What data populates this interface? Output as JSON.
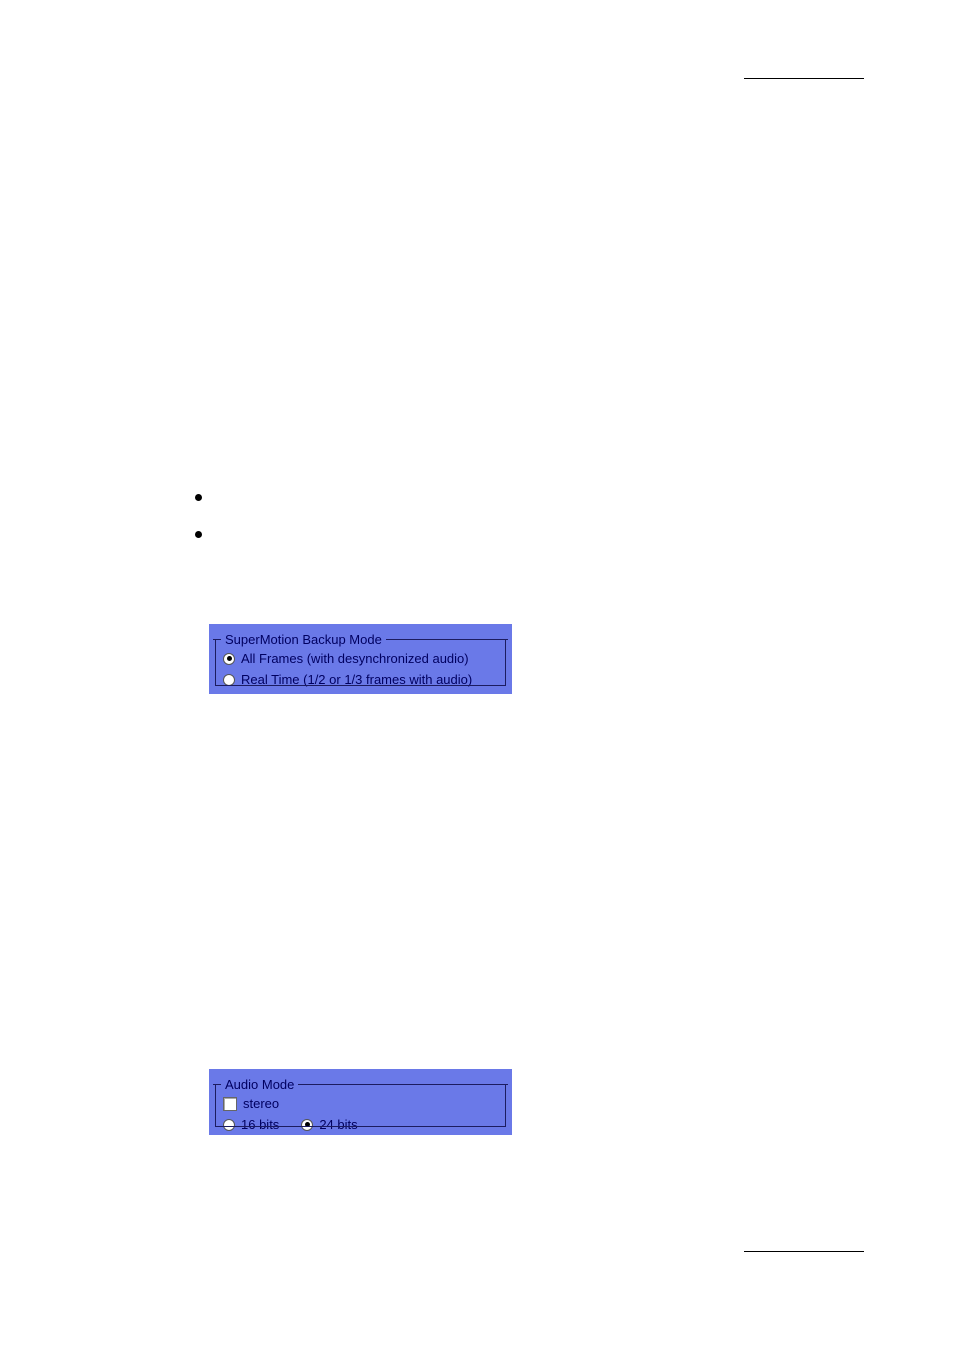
{
  "supermotion": {
    "legend": "SuperMotion Backup Mode",
    "option1_label": "All Frames (with desynchronized audio)",
    "option2_label": "Real Time (1/2 or 1/3 frames with audio)",
    "selected_index": 0
  },
  "audio": {
    "legend": "Audio Mode",
    "checkbox_label": "stereo",
    "checkbox_checked": false,
    "bits16_label": "16 bits",
    "bits24_label": "24 bits",
    "selected_bits_index": 1
  }
}
